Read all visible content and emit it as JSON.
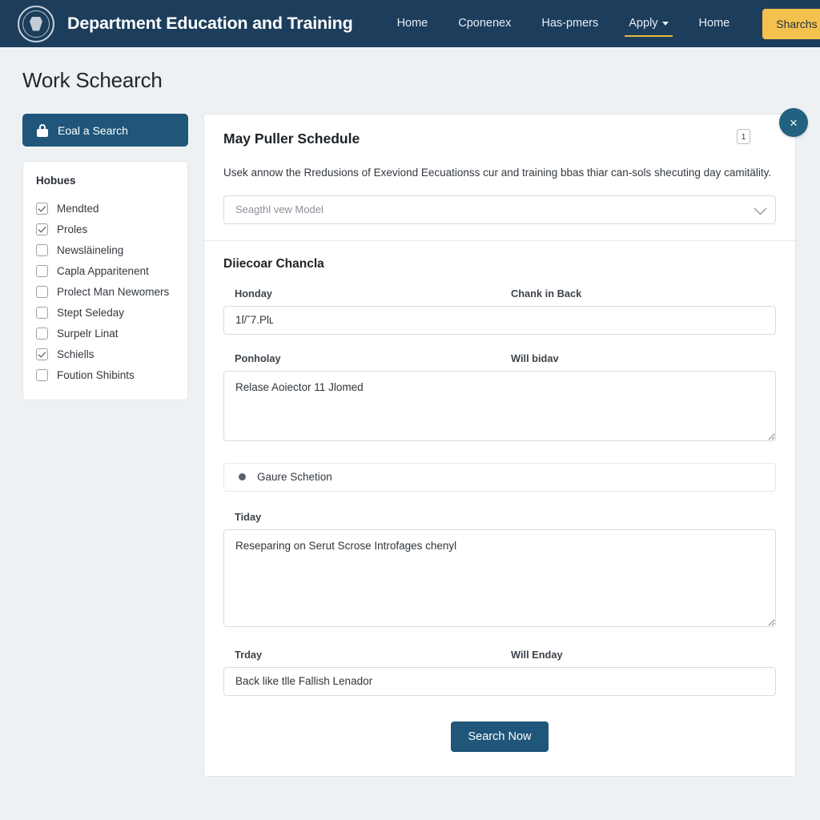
{
  "header": {
    "brand_title": "Department Education and Training",
    "seal_icon": "government-seal-icon",
    "nav": [
      {
        "label": "Home",
        "active": false,
        "has_caret": false
      },
      {
        "label": "Cponenex",
        "active": false,
        "has_caret": false
      },
      {
        "label": "Has-pmers",
        "active": false,
        "has_caret": false
      },
      {
        "label": "Apply",
        "active": true,
        "has_caret": true
      },
      {
        "label": "Home",
        "active": false,
        "has_caret": false
      }
    ],
    "cta_label": "Sharchs Seharact",
    "cta_color": "#f5c14e",
    "background_color": "#1c3d5c"
  },
  "page": {
    "title": "Work Schearch"
  },
  "sidebar": {
    "saved_search_label": "Eoal a Search",
    "saved_search_icon": "lock-icon",
    "facet_title": "Hobues",
    "facets": [
      {
        "label": "Mendted",
        "checked": true
      },
      {
        "label": "Proles",
        "checked": true
      },
      {
        "label": "Newsläineling",
        "checked": false
      },
      {
        "label": "Capla Apparitenent",
        "checked": false
      },
      {
        "label": "Prolect Man Newomers",
        "checked": false
      },
      {
        "label": "Stept Seleday",
        "checked": false
      },
      {
        "label": "Surpelr Linat",
        "checked": false
      },
      {
        "label": "Schiells",
        "checked": true
      },
      {
        "label": "Foution Shibints",
        "checked": false
      }
    ]
  },
  "card": {
    "title": "May Puller Schedule",
    "description": "Usek annow the Rredusions of Exeviond Eecuationss cur and training bbas thiar can-sols shecuting day camitälity.",
    "badge_count": "1",
    "close_label": "×",
    "select_placeholder": "Seagthl ᴠew Model",
    "section_title": "Diiecoar Chancla",
    "fields": {
      "row1_left_label": "Honday",
      "row1_right_label": "Chank in Back",
      "row1_value": "1ſ/ˇ7.Plʟ",
      "row2_left_label": "Ponholay",
      "row2_right_label": "Will bidav",
      "row2_value": "Relase Aoiector 11 Jlomed",
      "radio_label": "Gaure Schetion",
      "row3_label": "Tiday",
      "row3_value": "Reseparing on Serut Scrose Introfages chenyl",
      "row4_left_label": "Trday",
      "row4_right_label": "Will Enday",
      "row4_value": "Back like tlle Fallish Lenador"
    },
    "submit_label": "Search Now",
    "accent_color": "#1f5679"
  }
}
